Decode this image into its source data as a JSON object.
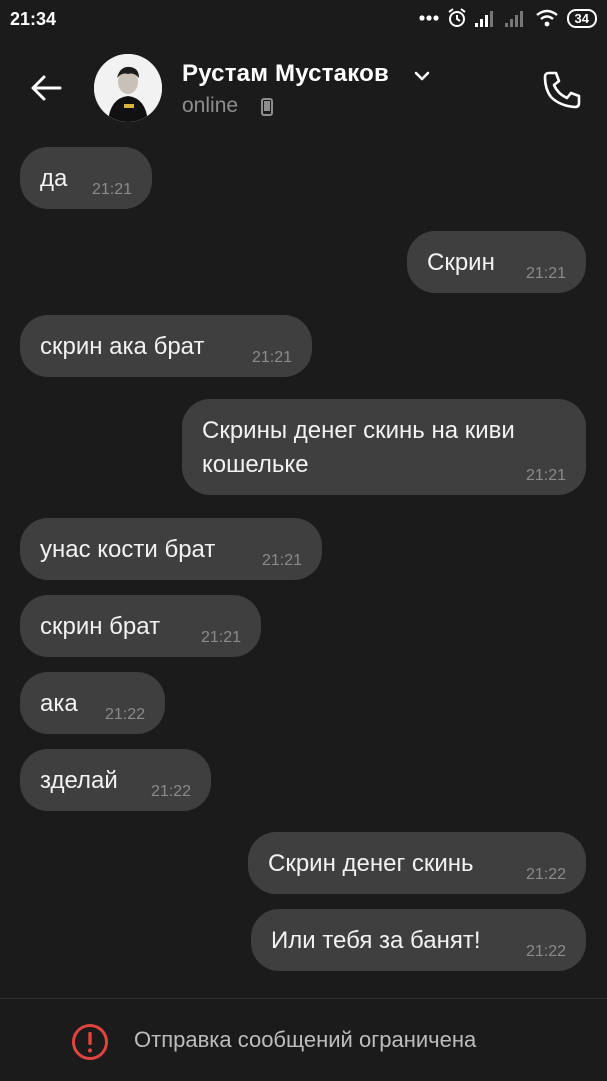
{
  "status_bar": {
    "time": "21:34",
    "battery": "34",
    "icons": [
      "more-dots-icon",
      "alarm-icon",
      "signal-icon",
      "signal-icon",
      "wifi-icon",
      "battery-icon"
    ]
  },
  "header": {
    "contact_name": "Рустам Мустаков",
    "presence": "online"
  },
  "messages": [
    {
      "side": "in",
      "text": "да",
      "time": "21:21"
    },
    {
      "side": "out",
      "text": "Скрин",
      "time": "21:21"
    },
    {
      "side": "in",
      "text": "скрин ака брат",
      "time": "21:21"
    },
    {
      "side": "out",
      "text": "Скрины денег скинь на киви кошельке",
      "time": "21:21"
    },
    {
      "side": "in",
      "text": "унас кости брат",
      "time": "21:21"
    },
    {
      "side": "in",
      "text": "скрин брат",
      "time": "21:21"
    },
    {
      "side": "in",
      "text": "ака",
      "time": "21:22"
    },
    {
      "side": "in",
      "text": "зделай",
      "time": "21:22"
    },
    {
      "side": "out",
      "text": "Скрин денег скинь",
      "time": "21:22"
    },
    {
      "side": "out",
      "text": "Или тебя за банят!",
      "time": "21:22"
    }
  ],
  "footer": {
    "notice": "Отправка сообщений ограничена"
  },
  "colors": {
    "background": "#1b1b1b",
    "bubble": "#3f3f3f",
    "alert": "#e0443e"
  }
}
